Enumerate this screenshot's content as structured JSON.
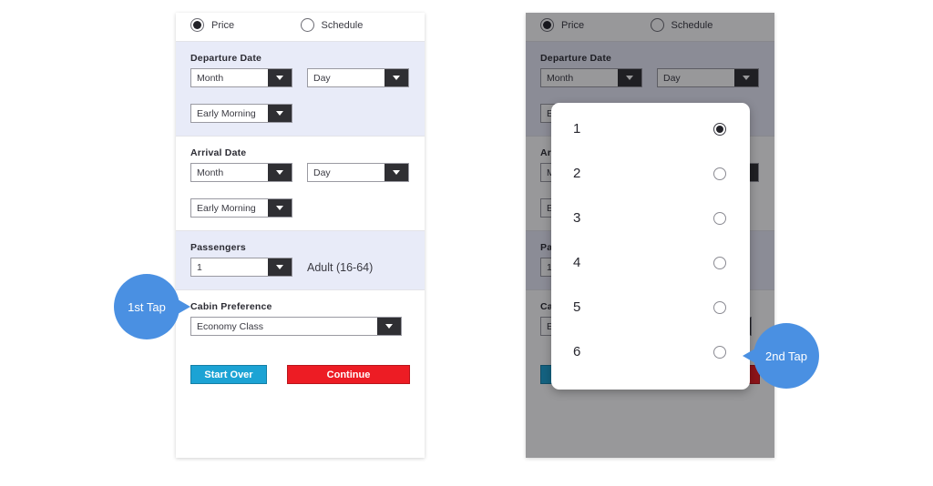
{
  "theme": {
    "panel_bg": "#ffffff",
    "section_alt_bg": "#e8ebf8",
    "select_button_bg": "#2f2f33",
    "start_over_color": "#1ca3d4",
    "continue_color": "#ed1c24",
    "callout_color": "#4a90e2",
    "overlay_color": "rgba(10,10,14,0.42)"
  },
  "form": {
    "sort_options": [
      {
        "label": "Price",
        "selected": true
      },
      {
        "label": "Schedule",
        "selected": false
      }
    ],
    "departure": {
      "label": "Departure Date",
      "month_value": "Month",
      "day_value": "Day",
      "time_value": "Early Morning"
    },
    "arrival": {
      "label": "Arrival Date",
      "month_value": "Month",
      "day_value": "Day",
      "time_value": "Early Morning"
    },
    "passengers": {
      "label": "Passengers",
      "count_value": "1",
      "note": "Adult (16-64)"
    },
    "cabin": {
      "label": "Cabin Preference",
      "value": "Economy Class"
    },
    "actions": {
      "start_over": "Start Over",
      "continue": "Continue"
    }
  },
  "modal": {
    "options": [
      {
        "label": "1",
        "selected": true
      },
      {
        "label": "2",
        "selected": false
      },
      {
        "label": "3",
        "selected": false
      },
      {
        "label": "4",
        "selected": false
      },
      {
        "label": "5",
        "selected": false
      },
      {
        "label": "6",
        "selected": false
      }
    ]
  },
  "callouts": {
    "first": "1st Tap",
    "second": "2nd Tap"
  }
}
